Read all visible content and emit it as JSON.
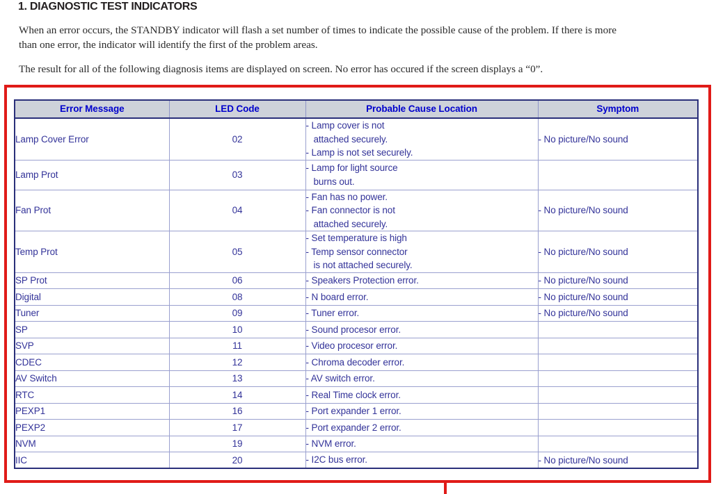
{
  "document": {
    "title": "1. DIAGNOSTIC TEST INDICATORS",
    "paragraph1_line1": "When an error occurs, the STANDBY indicator will flash a set number of times to indicate the possible cause of the problem. If there is more",
    "paragraph1_line2": "than one error, the indicator will identify the first of the problem areas.",
    "paragraph2": "The result for all of the following diagnosis items are displayed on screen. No error has occured if the screen displays a “0”."
  },
  "colors": {
    "annotation_red": "#e01b18",
    "table_border_navy": "#2a2f7a",
    "header_fill_gray": "#ced2da",
    "header_text_blue": "#0000cc",
    "body_text_blue": "#333399",
    "title_text": "#231f20"
  },
  "table": {
    "headers": [
      "Error Message",
      "LED Code",
      "Probable Cause Location",
      "Symptom"
    ],
    "rows": [
      {
        "error_message": "Lamp Cover Error",
        "led_code": "02",
        "probable_cause": [
          "- Lamp cover is not",
          "   attached securely.",
          "- Lamp is not set securely."
        ],
        "symptom": "- No picture/No sound",
        "size": "tall"
      },
      {
        "error_message": "Lamp Prot",
        "led_code": "03",
        "probable_cause": [
          "- Lamp for light source",
          "   burns out."
        ],
        "symptom": "",
        "size": "mid"
      },
      {
        "error_message": "Fan Prot",
        "led_code": "04",
        "probable_cause": [
          "- Fan has no power.",
          "- Fan connector is not",
          "   attached securely."
        ],
        "symptom": "- No picture/No sound",
        "size": "tall"
      },
      {
        "error_message": "Temp Prot",
        "led_code": "05",
        "probable_cause": [
          "- Set temperature is high",
          "- Temp sensor connector",
          "   is not attached securely."
        ],
        "symptom": "- No picture/No sound",
        "size": "tall"
      },
      {
        "error_message": "SP Prot",
        "led_code": "06",
        "probable_cause": [
          "- Speakers Protection error."
        ],
        "symptom": "- No picture/No sound",
        "size": "short"
      },
      {
        "error_message": "Digital",
        "led_code": "08",
        "probable_cause": [
          "- N board error."
        ],
        "symptom": "- No picture/No sound",
        "size": "short"
      },
      {
        "error_message": "Tuner",
        "led_code": "09",
        "probable_cause": [
          "- Tuner error."
        ],
        "symptom": "- No picture/No sound",
        "size": "short"
      },
      {
        "error_message": "SP",
        "led_code": "10",
        "probable_cause": [
          "- Sound procesor error."
        ],
        "symptom": "",
        "size": "short"
      },
      {
        "error_message": "SVP",
        "led_code": "11",
        "probable_cause": [
          "- Video procesor error."
        ],
        "symptom": "",
        "size": "short"
      },
      {
        "error_message": "CDEC",
        "led_code": "12",
        "probable_cause": [
          "- Chroma decoder error."
        ],
        "symptom": "",
        "size": "short"
      },
      {
        "error_message": "AV Switch",
        "led_code": "13",
        "probable_cause": [
          "- AV switch error."
        ],
        "symptom": "",
        "size": "short"
      },
      {
        "error_message": "RTC",
        "led_code": "14",
        "probable_cause": [
          "- Real Time clock error."
        ],
        "symptom": "",
        "size": "short"
      },
      {
        "error_message": "PEXP1",
        "led_code": "16",
        "probable_cause": [
          "- Port expander 1 error."
        ],
        "symptom": "",
        "size": "short"
      },
      {
        "error_message": "PEXP2",
        "led_code": "17",
        "probable_cause": [
          "- Port expander 2 error."
        ],
        "symptom": "",
        "size": "short"
      },
      {
        "error_message": "NVM",
        "led_code": "19",
        "probable_cause": [
          "- NVM error."
        ],
        "symptom": "",
        "size": "short"
      },
      {
        "error_message": "IIC",
        "led_code": "20",
        "probable_cause": [
          "- I2C bus error."
        ],
        "symptom": "- No picture/No sound",
        "size": "short"
      }
    ]
  }
}
